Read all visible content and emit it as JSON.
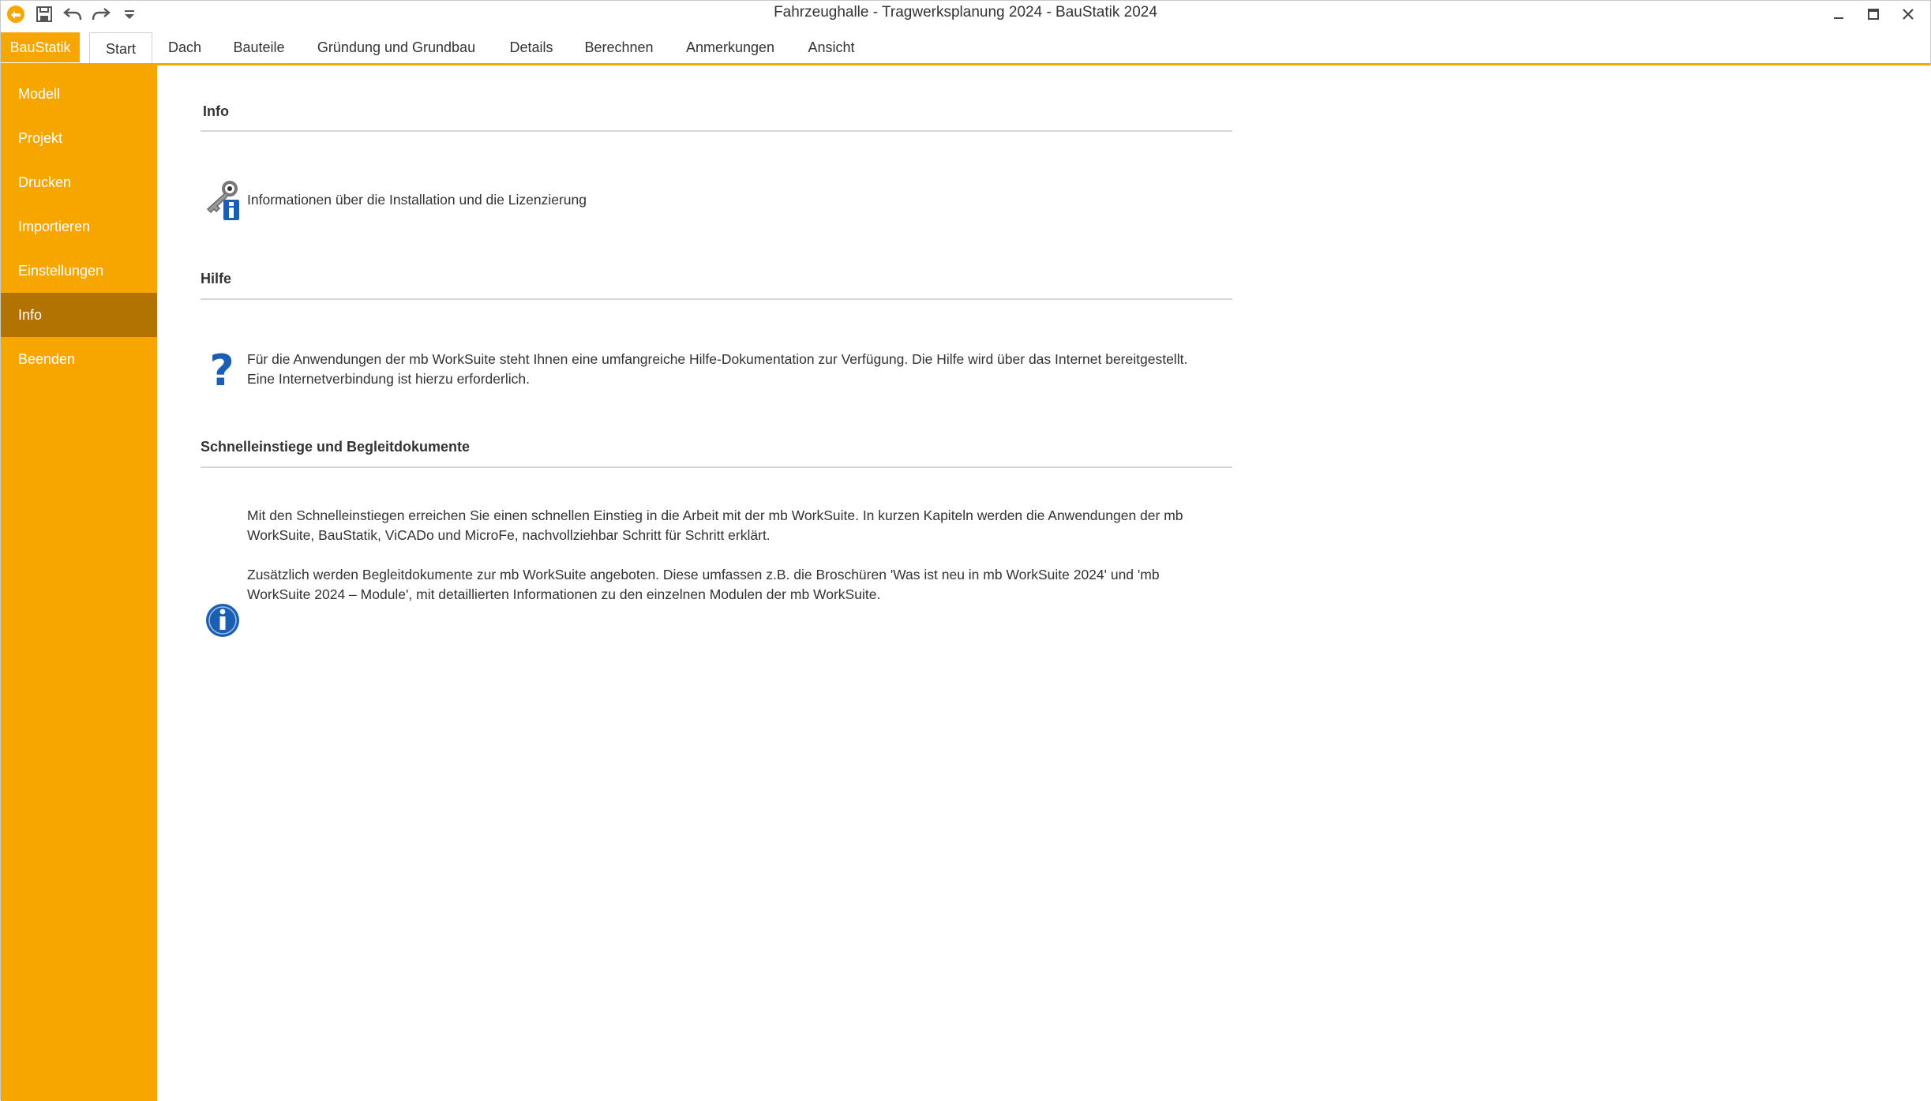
{
  "window": {
    "title": "Fahrzeughalle - Tragwerksplanung 2024 - BauStatik 2024",
    "accent_color": "#f7a600",
    "selected_color": "#b27300"
  },
  "quick_access": [
    {
      "name": "app-logo-icon"
    },
    {
      "name": "save-icon"
    },
    {
      "name": "undo-icon"
    },
    {
      "name": "redo-icon"
    },
    {
      "name": "customize-dropdown-icon"
    }
  ],
  "window_controls": [
    "minimize-icon",
    "maximize-icon",
    "close-icon"
  ],
  "ribbon": {
    "app_tab": "BauStatik",
    "tabs": [
      "Start",
      "Dach",
      "Bauteile",
      "Gründung und Grundbau",
      "Details",
      "Berechnen",
      "Anmerkungen",
      "Ansicht"
    ],
    "active_tab": "Start",
    "help_glyph": "?"
  },
  "sidebar": {
    "items": [
      "Modell",
      "Projekt",
      "Drucken",
      "Importieren",
      "Einstellungen",
      "Info",
      "Beenden"
    ],
    "selected": "Info"
  },
  "sections": {
    "info": {
      "title": "Info",
      "text": "Informationen über die Installation und die Lizenzierung",
      "icon": "key-info-icon"
    },
    "hilfe": {
      "title": "Hilfe",
      "line1": "Für die Anwendungen der mb WorkSuite steht Ihnen eine umfangreiche Hilfe-Dokumentation zur Verfügung. Die Hilfe wird über das Internet bereitgestellt.",
      "line2": "Eine Internetverbindung ist hierzu erforderlich.",
      "icon": "question-mark-icon",
      "icon_glyph": "?"
    },
    "schnell": {
      "title": "Schnelleinstiege und Begleitdokumente",
      "p1_line1": "Mit den Schnelleinstiegen erreichen Sie einen schnellen Einstieg in die Arbeit mit der mb WorkSuite. In kurzen Kapiteln werden die Anwendungen der mb",
      "p1_line2": "WorkSuite, BauStatik, ViCADo und MicroFe, nachvollziehbar Schritt für Schritt erklärt.",
      "p2_line1": "Zusätzlich werden Begleitdokumente zur mb WorkSuite angeboten. Diese umfassen z.B. die Broschüren 'Was ist neu in mb WorkSuite 2024' und 'mb",
      "p2_line2": "WorkSuite 2024 – Module', mit detaillierten Informationen zu den einzelnen Modulen der mb WorkSuite.",
      "icon": "info-circle-icon",
      "icon_glyph": "i"
    }
  }
}
